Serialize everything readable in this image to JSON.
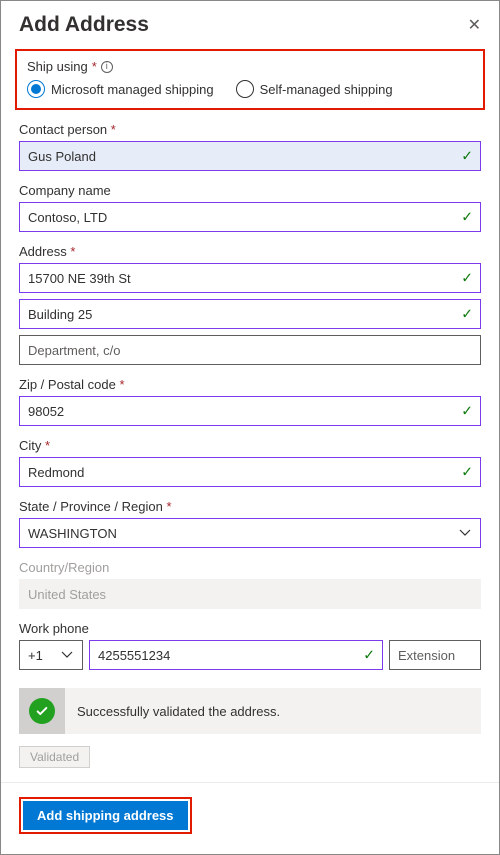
{
  "header": {
    "title": "Add Address"
  },
  "ship_using": {
    "label": "Ship using",
    "options": {
      "managed": "Microsoft managed shipping",
      "self": "Self-managed shipping"
    },
    "selected": "managed"
  },
  "fields": {
    "contact_person": {
      "label": "Contact person",
      "value": "Gus Poland"
    },
    "company_name": {
      "label": "Company name",
      "value": "Contoso, LTD"
    },
    "address": {
      "label": "Address",
      "line1": "15700 NE 39th St",
      "line2": "Building 25",
      "line3_placeholder": "Department, c/o"
    },
    "zip": {
      "label": "Zip / Postal code",
      "value": "98052"
    },
    "city": {
      "label": "City",
      "value": "Redmond"
    },
    "state": {
      "label": "State / Province / Region",
      "value": "WASHINGTON"
    },
    "country": {
      "label": "Country/Region",
      "value": "United States"
    },
    "work_phone": {
      "label": "Work phone",
      "cc": "+1",
      "number": "4255551234",
      "ext_placeholder": "Extension"
    }
  },
  "validation": {
    "message": "Successfully validated the address.",
    "pill": "Validated"
  },
  "footer": {
    "add_button": "Add shipping address"
  }
}
